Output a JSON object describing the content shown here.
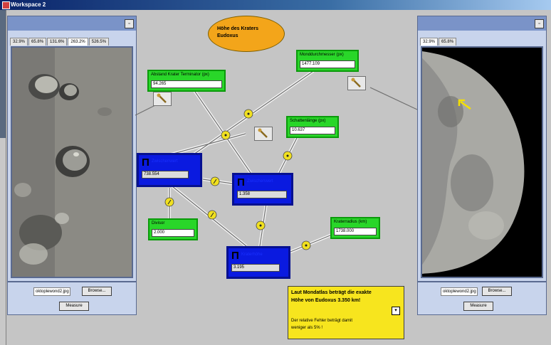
{
  "window": {
    "title": "Workspace 2"
  },
  "left_panel": {
    "tabs": [
      "32.9%",
      "65.8%",
      "131.6%",
      "263.2%",
      "526.5%"
    ],
    "active_tab": 3,
    "file": "oktoplewond2.jpg",
    "browse": "Browse...",
    "measure": "Measure",
    "maximize": "▫"
  },
  "right_panel": {
    "tabs": [
      "32.9%",
      "65.8%"
    ],
    "active_tab": 0,
    "file": "oktoplewond2.jpg",
    "browse": "Browse...",
    "measure": "Measure",
    "maximize": "▫"
  },
  "title_ellipse": {
    "line1": "Höhe des Kraters",
    "line2": "Eudoxus"
  },
  "inputs": {
    "abstand": {
      "label": "Abstand Krater Terminator (px)",
      "value": "94.265"
    },
    "monddurchmesser": {
      "label": "Monddurchmesser (px)",
      "value": "1477.109"
    },
    "schattenlaenge": {
      "label": "Schattenlänge (px)",
      "value": "10.637"
    },
    "divisor": {
      "label": "Divisor",
      "value": "2.000"
    },
    "kraterradius": {
      "label": "Kraterradius (km)",
      "value": "1738.000"
    }
  },
  "results": {
    "r1": {
      "label": "Zwischenwert",
      "value": "738.554"
    },
    "r2": {
      "label": "Zwischenwert",
      "value": "1.358"
    },
    "r3": {
      "label": "Kraterhöhe",
      "value": "3.195"
    }
  },
  "note": {
    "line1": "Laut Mondatlas beträgt die exakte",
    "line2": "Höhe von Eudoxus 3.350 km!",
    "line3": "Der relative Fehler beträgt damit",
    "line4": "weniger als 5% !",
    "icon": "download-icon"
  },
  "colors": {
    "input_box": "#29d629",
    "result_box": "#0a1ae0",
    "node": "#f0e020",
    "note": "#f7e51e"
  }
}
